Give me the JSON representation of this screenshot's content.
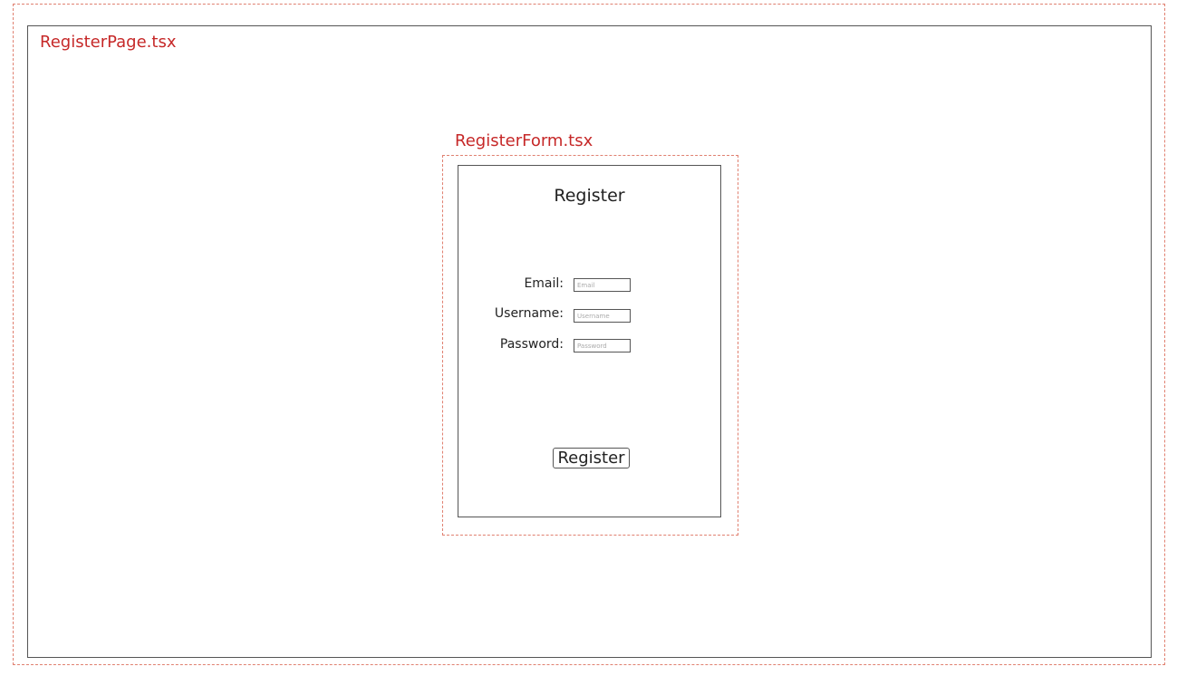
{
  "page": {
    "label": "RegisterPage.tsx"
  },
  "form": {
    "label": "RegisterForm.tsx",
    "title": "Register",
    "fields": [
      {
        "label": "Email:",
        "placeholder": "Email",
        "value": ""
      },
      {
        "label": "Username:",
        "placeholder": "Username",
        "value": ""
      },
      {
        "label": "Password:",
        "placeholder": "Password",
        "value": ""
      }
    ],
    "submit_label": "Register"
  },
  "colors": {
    "annotation": "#c62828",
    "annotation_border": "#e08070",
    "frame_border": "#555555"
  }
}
